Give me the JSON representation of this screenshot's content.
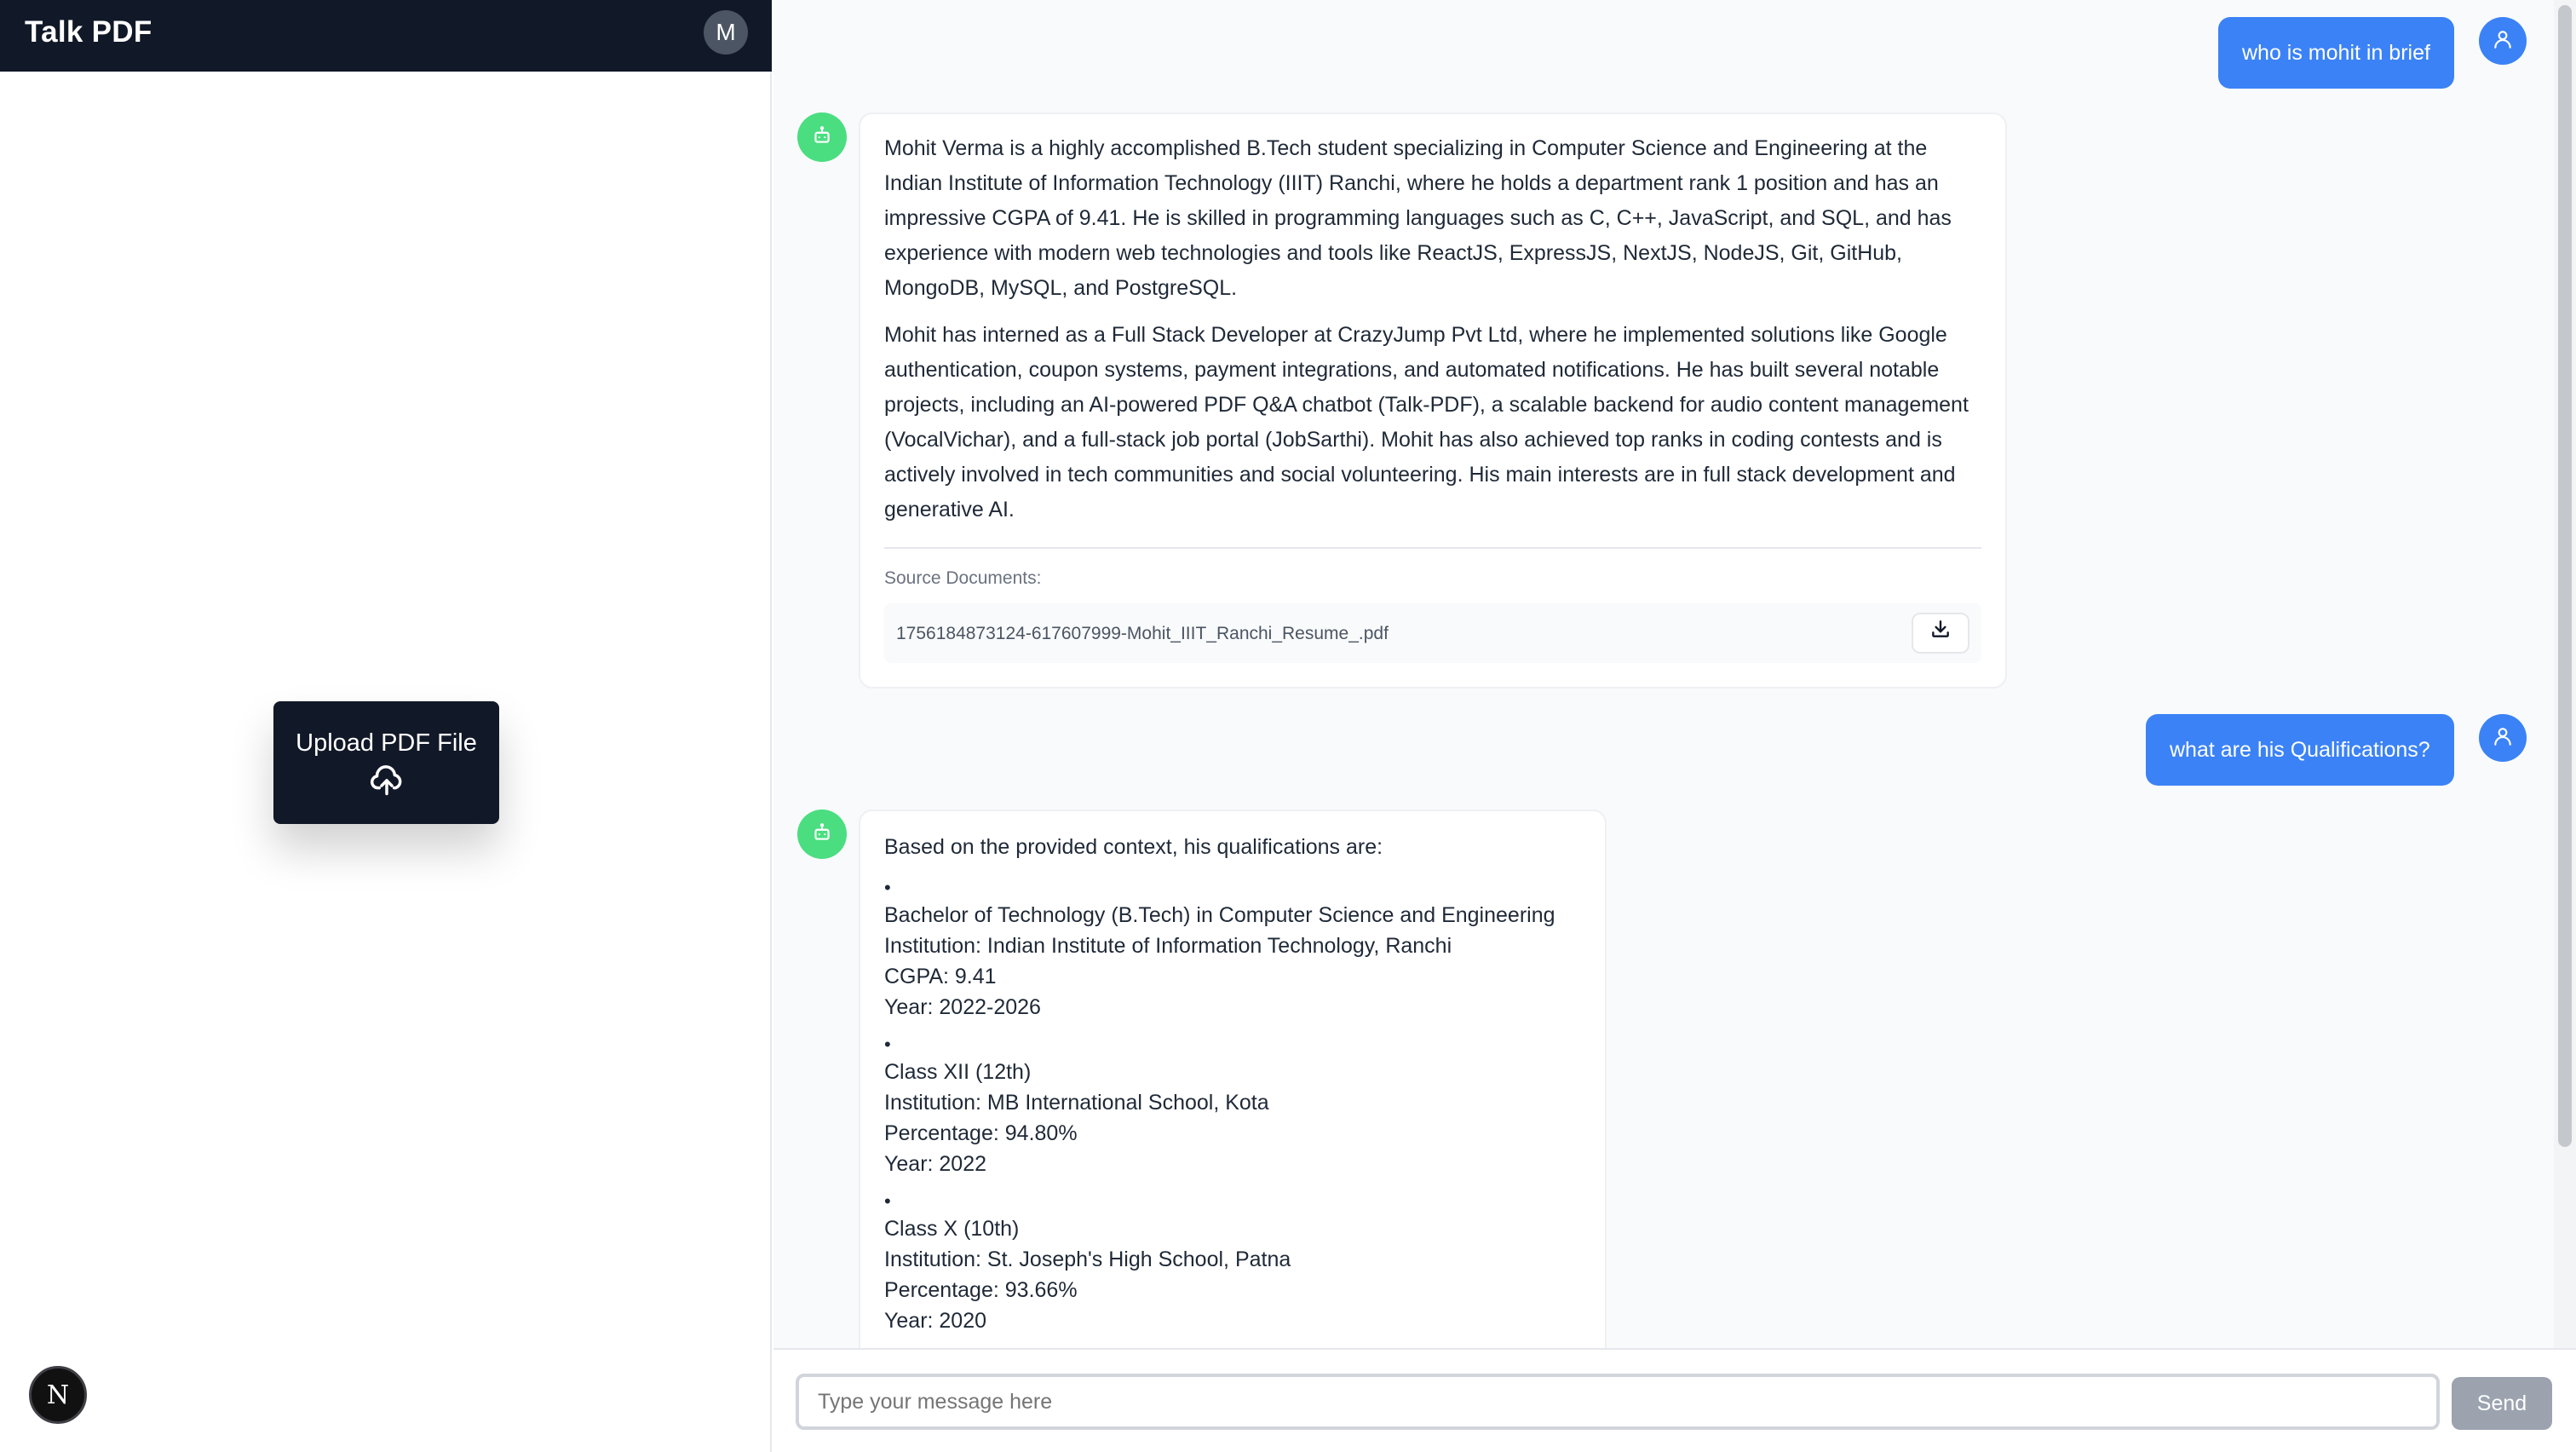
{
  "app": {
    "title": "Talk PDF",
    "avatar_initial": "M"
  },
  "sidebar": {
    "upload_label": "Upload PDF File",
    "upload_icon": "cloud-upload-icon",
    "next_badge": "N"
  },
  "messages": {
    "user1": {
      "text": "who is mohit in brief"
    },
    "bot1": {
      "para1": "Mohit Verma is a highly accomplished B.Tech student specializing in Computer Science and Engineering at the Indian Institute of Information Technology (IIIT) Ranchi, where he holds a department rank 1 position and has an impressive CGPA of 9.41. He is skilled in programming languages such as C, C++, JavaScript, and SQL, and has experience with modern web technologies and tools like ReactJS, ExpressJS, NextJS, NodeJS, Git, GitHub, MongoDB, MySQL, and PostgreSQL.",
      "para2": "Mohit has interned as a Full Stack Developer at CrazyJump Pvt Ltd, where he implemented solutions like Google authentication, coupon systems, payment integrations, and automated notifications. He has built several notable projects, including an AI-powered PDF Q&A chatbot (Talk-PDF), a scalable backend for audio content management (VocalVichar), and a full-stack job portal (JobSarthi). Mohit has also achieved top ranks in coding contests and is actively involved in tech communities and social volunteering. His main interests are in full stack development and generative AI.",
      "sources_title": "Source Documents:",
      "source_file": "1756184873124-617607999-Mohit_IIIT_Ranchi_Resume_.pdf"
    },
    "user2": {
      "text": "what are his Qualifications?"
    },
    "bot2": {
      "intro": "Based on the provided context, his qualifications are:",
      "items": [
        {
          "l1": "Bachelor of Technology (B.Tech) in Computer Science and Engineering",
          "l2": "Institution: Indian Institute of Information Technology, Ranchi",
          "l3": "CGPA: 9.41",
          "l4": "Year: 2022-2026"
        },
        {
          "l1": "Class XII (12th)",
          "l2": "Institution: MB International School, Kota",
          "l3": "Percentage: 94.80%",
          "l4": "Year: 2022"
        },
        {
          "l1": "Class X (10th)",
          "l2": "Institution: St. Joseph's High School, Patna",
          "l3": "Percentage: 93.66%",
          "l4": "Year: 2020"
        }
      ]
    }
  },
  "input": {
    "placeholder": "Type your message here",
    "send_label": "Send"
  },
  "colors": {
    "header": "#111827",
    "user_bubble": "#3b82f6",
    "bot_avatar": "#4ade80",
    "send_disabled": "#9ca3af"
  }
}
